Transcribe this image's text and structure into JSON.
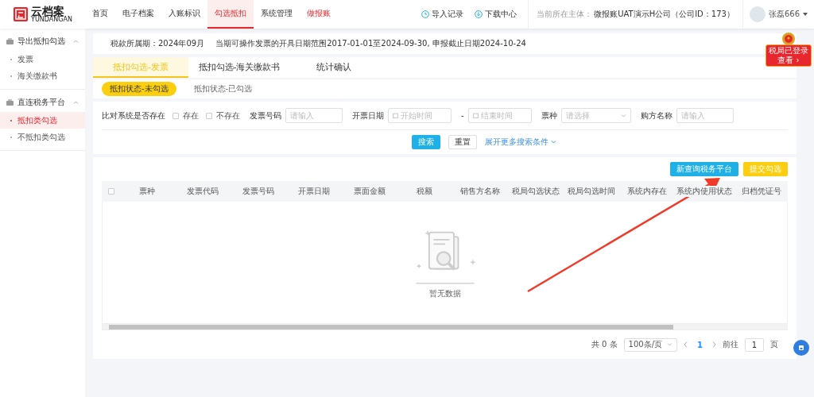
{
  "logo": {
    "name": "云档案",
    "subtitle": "YUNDANGAN"
  },
  "nav": [
    {
      "label": "首页",
      "selected": false,
      "highlight": false
    },
    {
      "label": "电子档案",
      "selected": false,
      "highlight": false
    },
    {
      "label": "入账标识",
      "selected": false,
      "highlight": false
    },
    {
      "label": "勾选抵扣",
      "selected": true,
      "highlight": false
    },
    {
      "label": "系统管理",
      "selected": false,
      "highlight": false
    },
    {
      "label": "做报账",
      "selected": false,
      "highlight": true
    }
  ],
  "header_links": [
    {
      "label": "导入记录",
      "kind": "clock"
    },
    {
      "label": "下载中心",
      "kind": "download"
    }
  ],
  "entity": {
    "label": "当前所在主体：",
    "value": "微报账UAT演示H公司（公司ID：173）"
  },
  "user": {
    "name": "张磊666"
  },
  "sidebar": [
    {
      "title": "导出抵扣勾选",
      "expanded": true,
      "items": [
        {
          "label": "发票",
          "selected": false
        },
        {
          "label": "海关缴款书",
          "selected": false
        }
      ]
    },
    {
      "title": "直连税务平台",
      "expanded": true,
      "items": [
        {
          "label": "抵扣类勾选",
          "selected": true
        },
        {
          "label": "不抵扣类勾选",
          "selected": false
        }
      ]
    }
  ],
  "period": {
    "label": "税款所属期：2024年09月",
    "notice": "当期可操作发票的开具日期范围2017-01-01至2024-09-30, 申报截止日期2024-10-24"
  },
  "tax_badge": {
    "status": "税局已登录",
    "link": "查看 ›"
  },
  "tabs": [
    {
      "label": "抵扣勾选-发票",
      "selected": true
    },
    {
      "label": "抵扣勾选-海关缴款书",
      "selected": false
    },
    {
      "label": "统计确认",
      "selected": false
    }
  ],
  "subtabs": [
    {
      "label": "抵扣状态-未勾选",
      "selected": true
    },
    {
      "label": "抵扣状态-已勾选",
      "selected": false
    }
  ],
  "filters": {
    "compare_label": "比对系统是否存在",
    "options": [
      {
        "label": "存在",
        "checked": false
      },
      {
        "label": "不存在",
        "checked": false
      }
    ],
    "fields": [
      {
        "label": "发票号码",
        "placeholder": "请输入",
        "kind": "text"
      },
      {
        "label": "开票日期",
        "placeholder": "开始时间",
        "kind": "date"
      },
      {
        "label": "-",
        "placeholder": "结束时间",
        "kind": "date"
      },
      {
        "label": "票种",
        "placeholder": "请选择",
        "kind": "select"
      },
      {
        "label": "购方名称",
        "placeholder": "请输入",
        "kind": "text"
      }
    ],
    "search": "搜索",
    "reset": "重置",
    "more": "展开更多搜索条件"
  },
  "actions": [
    {
      "label": "新查询税务平台",
      "kind": "primary"
    },
    {
      "label": "提交勾选",
      "kind": "warning"
    }
  ],
  "table": {
    "select_all": false,
    "columns": [
      "票种",
      "发票代码",
      "发票号码",
      "开票日期",
      "票面金额",
      "税额",
      "销售方名称",
      "税局勾选状态",
      "税局勾选时间",
      "系统内存在",
      "系统内使用状态",
      "归档凭证号"
    ],
    "empty": "暂无数据"
  },
  "pagination": {
    "total": "共 0 条",
    "page_size": "100条/页",
    "pages": [
      {
        "label": "1",
        "selected": true
      }
    ],
    "goto": "前往",
    "goto_value": "1",
    "goto_suffix": "页"
  }
}
